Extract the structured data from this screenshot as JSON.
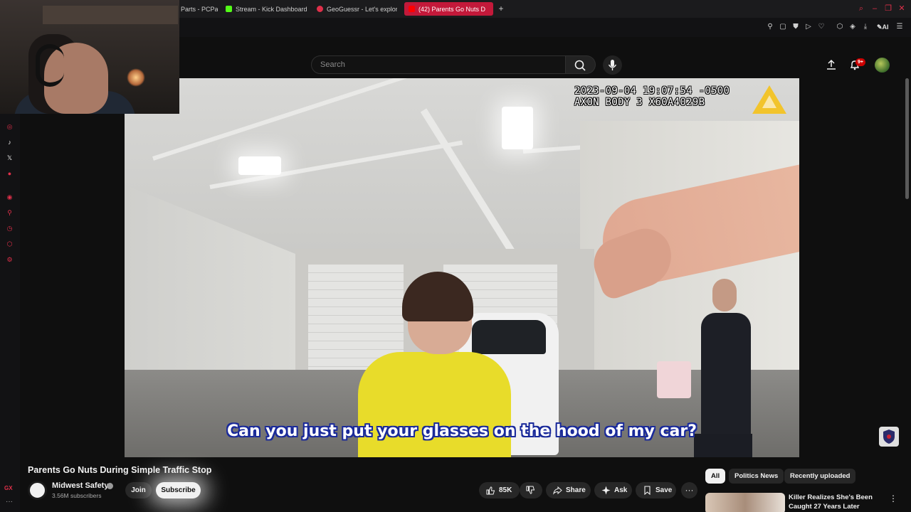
{
  "browser": {
    "tabs": [
      {
        "label": "Parts - PCPa",
        "color": "#4a4a4a"
      },
      {
        "label": "Stream - Kick Dashboard",
        "color": "#53fc18"
      },
      {
        "label": "GeoGuessr - Let's explore",
        "color": "#e0304a"
      },
      {
        "label": "(42) Parents Go Nuts D",
        "color": "#ff0000",
        "active": true
      }
    ],
    "new_tab": "+",
    "ai_label": "AI"
  },
  "gx_sidebar": {
    "label": "GX",
    "more": "···",
    "icons": [
      "instagram-icon",
      "tiktok-icon",
      "x-icon",
      "twitch-icon",
      "player-icon",
      "pin-icon",
      "history-icon",
      "extensions-icon",
      "settings-icon"
    ]
  },
  "youtube": {
    "search": {
      "placeholder": "Search"
    },
    "notifications_badge": "9+",
    "video": {
      "timestamp_line1": "2023-09-04 19:07:54 -0500",
      "timestamp_line2": "AXON BODY 3 X60A4029B",
      "subtitle": "Can you just put your glasses on the hood of my car?"
    },
    "title": "Parents Go Nuts During Simple Traffic Stop",
    "channel": {
      "name": "Midwest Safety",
      "subscribers": "3.56M subscribers"
    },
    "buttons": {
      "join": "Join",
      "subscribe": "Subscribe",
      "likes": "85K",
      "share": "Share",
      "ask": "Ask",
      "save": "Save",
      "more": "···"
    },
    "chips": [
      {
        "label": "All",
        "selected": true
      },
      {
        "label": "Politics News",
        "selected": false
      },
      {
        "label": "Recently uploaded",
        "selected": false
      }
    ],
    "recommendation": {
      "title": "Killer Realizes She's Been Caught 27 Years Later"
    }
  },
  "colors": {
    "accent": "#e0304a",
    "youtube_red": "#cc0000",
    "subtitle_outline": "#1a2a9a",
    "shirt": "#e8dc2a"
  }
}
